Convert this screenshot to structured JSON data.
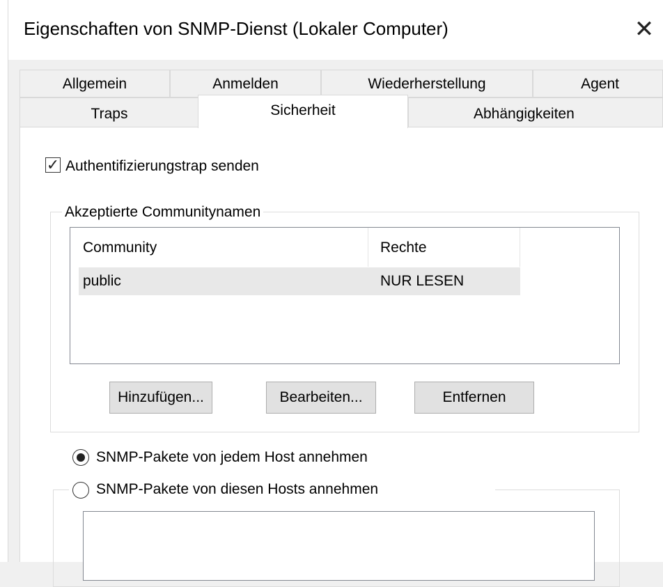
{
  "window": {
    "title": "Eigenschaften von SNMP-Dienst (Lokaler Computer)",
    "close_glyph": "✕"
  },
  "tabs": {
    "row1": [
      "Allgemein",
      "Anmelden",
      "Wiederherstellung",
      "Agent"
    ],
    "row2": [
      "Traps",
      "Sicherheit",
      "Abhängigkeiten"
    ],
    "active": "Sicherheit"
  },
  "security": {
    "auth_trap_label": "Authentifizierungstrap senden",
    "auth_trap_checked": true,
    "communities_group_label": "Akzeptierte Communitynamen",
    "columns": [
      "Community",
      "Rechte"
    ],
    "rows": [
      {
        "community": "public",
        "rights": "NUR LESEN"
      }
    ],
    "buttons": {
      "add": "Hinzufügen...",
      "edit": "Bearbeiten...",
      "remove": "Entfernen"
    },
    "radio_any_host": "SNMP-Pakete von jedem Host annehmen",
    "radio_these_hosts": "SNMP-Pakete von diesen Hosts annehmen",
    "selected_radio": "any_host"
  },
  "icons": {
    "close": "close-icon",
    "checkbox": "checkmark-icon",
    "radio": "radio-dot-icon"
  },
  "colors": {
    "window_bg": "#f0f0f0",
    "panel_bg": "#ffffff",
    "button_bg": "#e1e1e1",
    "selected_row_bg": "#e8e8e8"
  }
}
